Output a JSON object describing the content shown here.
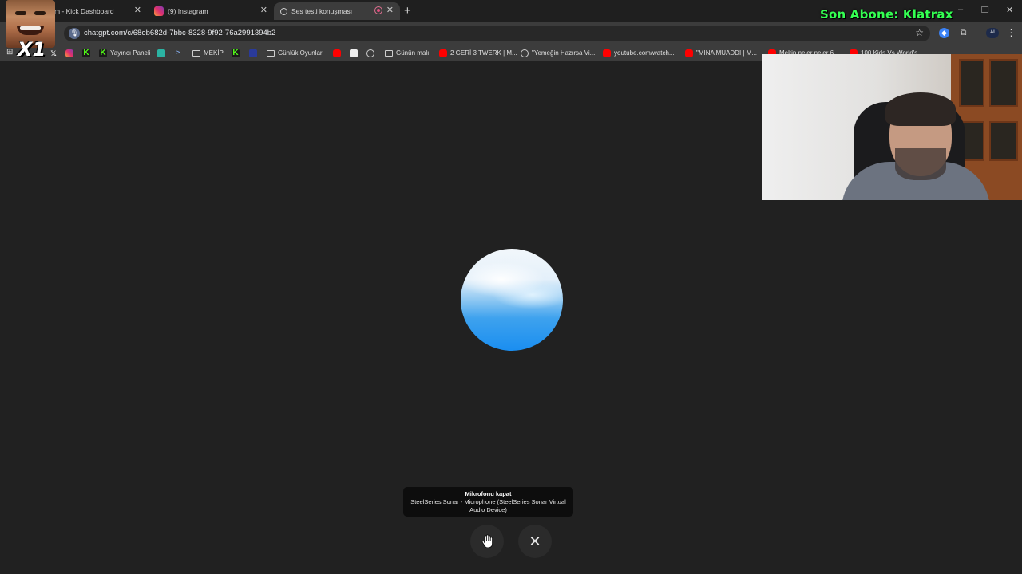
{
  "browser": {
    "tabs": [
      {
        "label": "m - Kick Dashboard",
        "favicon": "kick-icon",
        "active": false
      },
      {
        "label": "(9) Instagram",
        "favicon": "instagram-icon",
        "active": false
      },
      {
        "label": "Ses testi konuşması",
        "favicon": "chatgpt-icon",
        "active": true
      }
    ],
    "new_tab": "+",
    "window_controls": {
      "minimize": "–",
      "restore": "❐",
      "close": "✕"
    },
    "url": "chatgpt.com/c/68eb682d-7bbc-8328-9f92-76a2991394b2",
    "bookmarks": [
      {
        "label": "",
        "icon": "x-icon"
      },
      {
        "label": "",
        "icon": "instagram-icon"
      },
      {
        "label": "",
        "icon": "kick-icon"
      },
      {
        "label": "Yayıncı Paneli",
        "icon": "kick-icon"
      },
      {
        "label": "",
        "icon": "app-icon"
      },
      {
        "label": "",
        "icon": "terminal-icon"
      },
      {
        "label": "MEKİP",
        "icon": "folder-icon"
      },
      {
        "label": "",
        "icon": "kick-icon"
      },
      {
        "label": "",
        "icon": "app-icon"
      },
      {
        "label": "Günlük Oyunlar",
        "icon": "folder-icon"
      },
      {
        "label": "",
        "icon": "youtube-icon"
      },
      {
        "label": "",
        "icon": "image-icon"
      },
      {
        "label": "",
        "icon": "chatgpt-icon"
      },
      {
        "label": "Günün malı",
        "icon": "folder-icon"
      },
      {
        "label": "2 GERİ 3 TWERK | M...",
        "icon": "youtube-icon"
      },
      {
        "label": "\"Yemeğin Hazırsa Vi...",
        "icon": "chatgpt-icon"
      },
      {
        "label": "youtube.com/watch...",
        "icon": "youtube-icon"
      },
      {
        "label": "\"MINA MUADDI | M...",
        "icon": "youtube-icon"
      },
      {
        "label": "Mekip neler neler 6...",
        "icon": "youtube-icon"
      },
      {
        "label": "100 Kids Vs World's...",
        "icon": "youtube-icon"
      }
    ]
  },
  "stream_overlay": {
    "subscriber_banner": "Son Abone: Klatrax",
    "multiplier": "X1"
  },
  "voice_mode": {
    "tooltip_title": "Mikrofonu kapat",
    "tooltip_device": "SteelSeries Sonar - Microphone (SteelSeries Sonar Virtual Audio Device)",
    "close_symbol": "✕"
  },
  "colors": {
    "background": "#212121",
    "orb_blue": "#1a8ef0",
    "banner_green": "#34ff52"
  }
}
